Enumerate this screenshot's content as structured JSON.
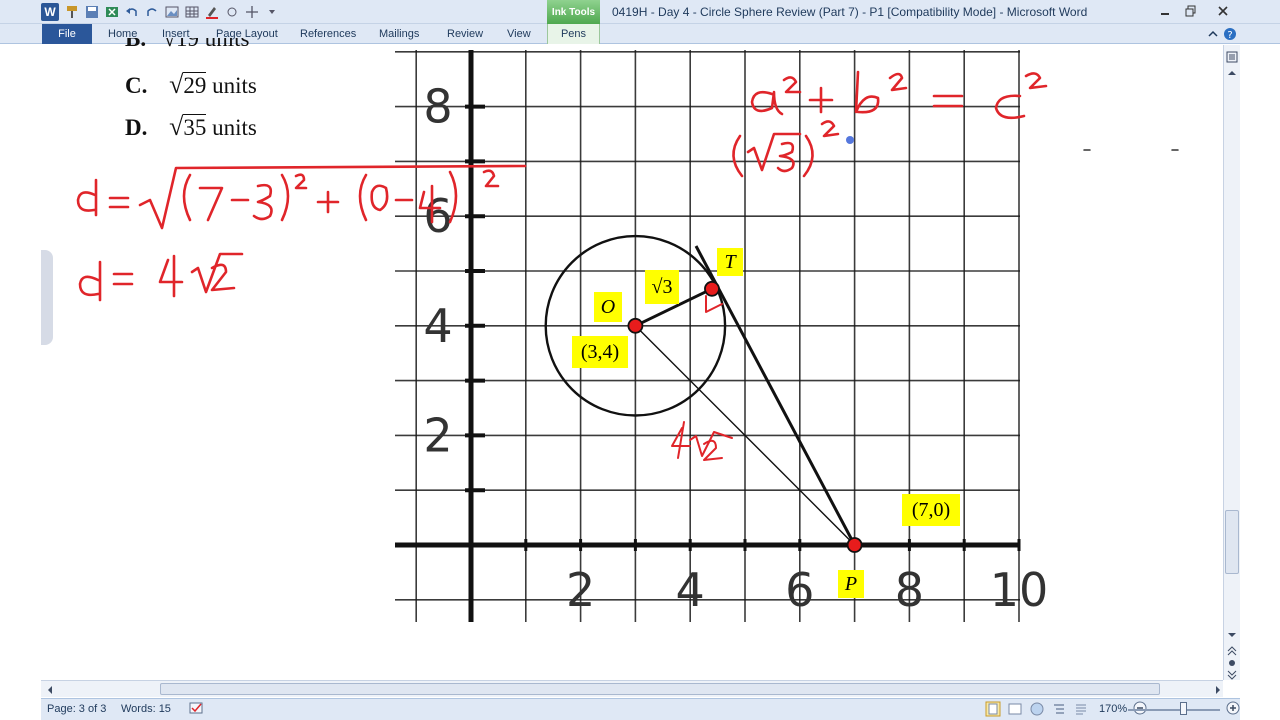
{
  "window": {
    "title": "0419H - Day 4 - Circle Sphere Review (Part 7) - P1 [Compatibility Mode] - Microsoft Word",
    "context_tab_group": "Ink Tools",
    "app_icon_letter": "W"
  },
  "ribbon": {
    "tabs": [
      "File",
      "Home",
      "Insert",
      "Page Layout",
      "References",
      "Mailings",
      "Review",
      "View",
      "Pens"
    ]
  },
  "document": {
    "options": [
      {
        "letter": "C.",
        "radicand": "29",
        "unit": "units"
      },
      {
        "letter": "D.",
        "radicand": "35",
        "unit": "units"
      }
    ],
    "graph": {
      "y_ticks": [
        "8",
        "6",
        "4",
        "2"
      ],
      "x_ticks": [
        "2",
        "4",
        "6",
        "8",
        "10"
      ],
      "labels": {
        "O": "O",
        "T": "T",
        "P": "P",
        "center": "(3,4)",
        "point_p": "(7,0)",
        "radius": "√3"
      },
      "points": {
        "O": [
          3,
          4
        ],
        "P": [
          7,
          0
        ],
        "T": [
          4.47,
          4.73
        ]
      },
      "circle_radius": 1.732
    },
    "handwriting": {
      "line1": "d = √(7−3)² + (0−4)²",
      "line2": "d = 4√2",
      "pythag": "a² + b² = c²",
      "sub": "(√3)²",
      "hyp_label": "4√2"
    }
  },
  "status": {
    "page": "Page: 3 of 3",
    "words": "Words: 15",
    "zoom": "170%"
  },
  "colors": {
    "ink": "#e0252a",
    "highlight": "#ffff00",
    "accent": "#2b579a"
  }
}
